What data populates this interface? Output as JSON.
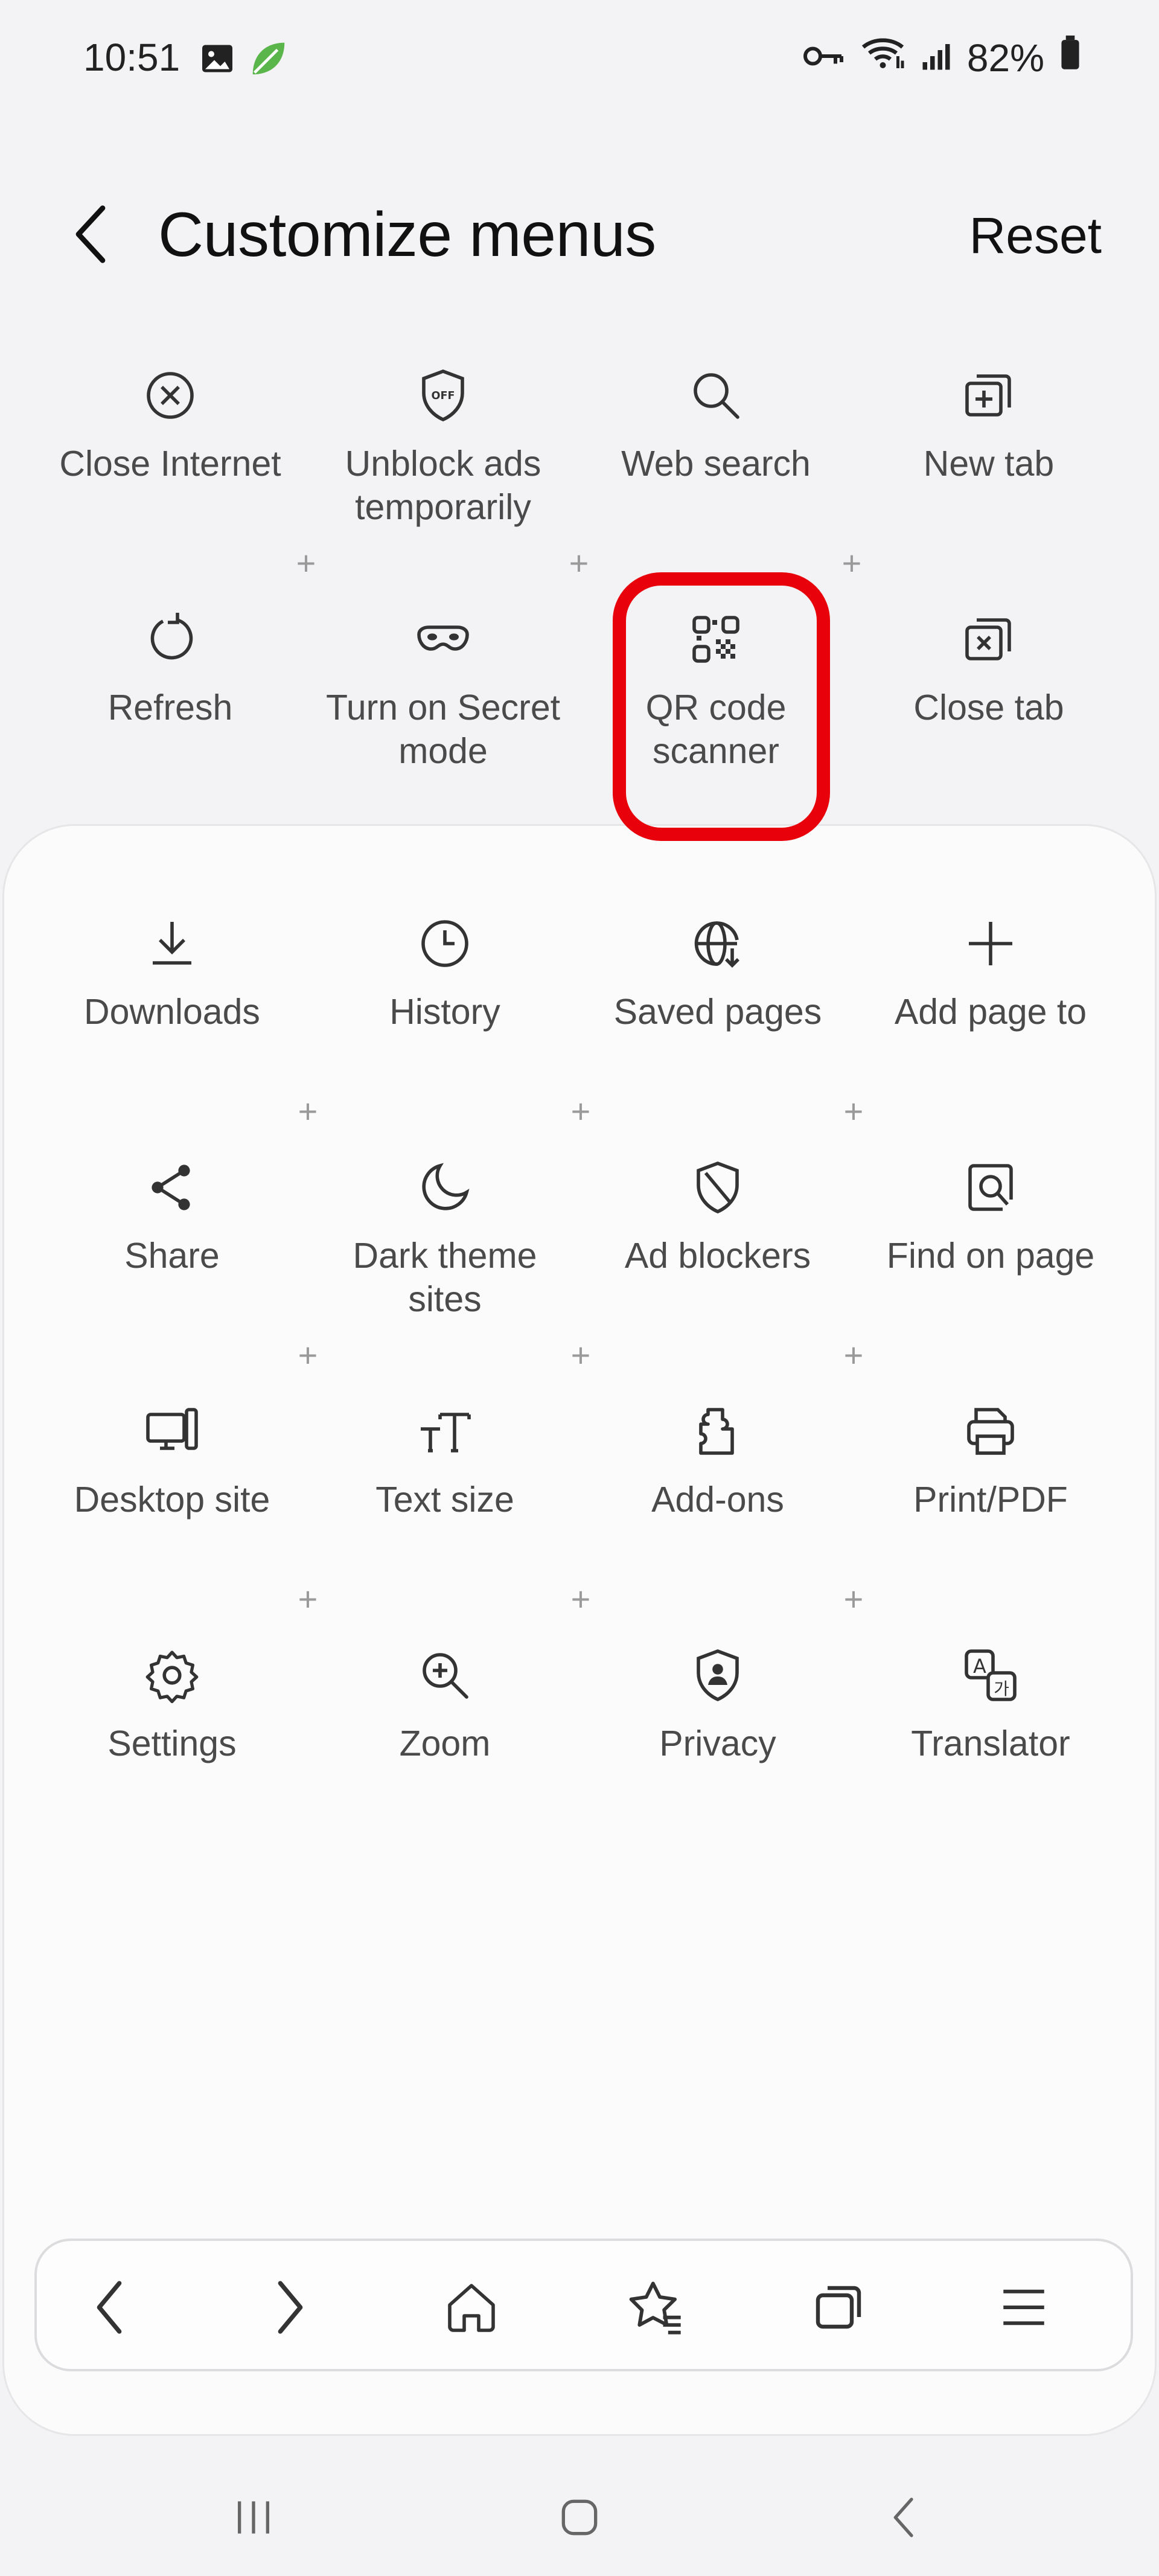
{
  "status_bar": {
    "time": "10:51",
    "battery": "82%",
    "icons": [
      "image-icon",
      "leaf-icon",
      "key-icon",
      "wifi-icon",
      "signal-icon",
      "battery-icon"
    ]
  },
  "header": {
    "title": "Customize menus",
    "reset_label": "Reset"
  },
  "top_menu": [
    {
      "label": "Close Internet",
      "icon": "close-circle-icon"
    },
    {
      "label": "Unblock ads temporarily",
      "icon": "shield-off-icon"
    },
    {
      "label": "Web search",
      "icon": "search-icon"
    },
    {
      "label": "New tab",
      "icon": "new-tab-icon"
    },
    {
      "label": "Refresh",
      "icon": "refresh-icon"
    },
    {
      "label": "Turn on Secret mode",
      "icon": "mask-icon"
    },
    {
      "label": "QR code scanner",
      "icon": "qr-icon"
    },
    {
      "label": "Close tab",
      "icon": "close-tab-icon"
    }
  ],
  "available_items": [
    {
      "label": "Downloads",
      "icon": "download-icon"
    },
    {
      "label": "History",
      "icon": "clock-icon"
    },
    {
      "label": "Saved pages",
      "icon": "globe-download-icon"
    },
    {
      "label": "Add page to",
      "icon": "plus-icon"
    },
    {
      "label": "Share",
      "icon": "share-icon"
    },
    {
      "label": "Dark theme sites",
      "icon": "moon-icon"
    },
    {
      "label": "Ad blockers",
      "icon": "shield-slash-icon"
    },
    {
      "label": "Find on page",
      "icon": "find-page-icon"
    },
    {
      "label": "Desktop site",
      "icon": "desktop-icon"
    },
    {
      "label": "Text size",
      "icon": "text-size-icon"
    },
    {
      "label": "Add-ons",
      "icon": "puzzle-icon"
    },
    {
      "label": "Print/PDF",
      "icon": "printer-icon"
    },
    {
      "label": "Settings",
      "icon": "gear-icon"
    },
    {
      "label": "Zoom",
      "icon": "zoom-in-icon"
    },
    {
      "label": "Privacy",
      "icon": "privacy-shield-icon"
    },
    {
      "label": "Translator",
      "icon": "translate-icon"
    }
  ],
  "bottom_toolbar": [
    "back-arrow-icon",
    "forward-arrow-icon",
    "home-icon",
    "bookmark-star-icon",
    "tabs-icon",
    "menu-icon"
  ],
  "nav_bar": [
    "recents-icon",
    "home-nav-icon",
    "back-nav-icon"
  ],
  "colors": {
    "highlight": "#e8000b",
    "background": "#f3f3f5",
    "panel": "#fbfbfb"
  }
}
